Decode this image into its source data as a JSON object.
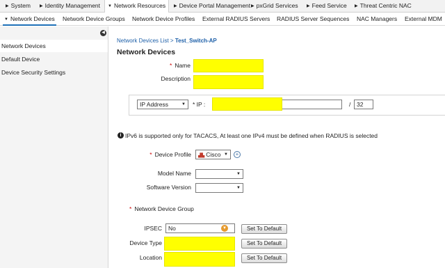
{
  "top_menu": [
    {
      "label": "System"
    },
    {
      "label": "Identity Management"
    },
    {
      "label": "Network Resources"
    },
    {
      "label": "Device Portal Management"
    },
    {
      "label": "pxGrid Services"
    },
    {
      "label": "Feed Service"
    },
    {
      "label": "Threat Centric NAC"
    }
  ],
  "sub_tabs": [
    {
      "label": "Network Devices"
    },
    {
      "label": "Network Device Groups"
    },
    {
      "label": "Network Device Profiles"
    },
    {
      "label": "External RADIUS Servers"
    },
    {
      "label": "RADIUS Server Sequences"
    },
    {
      "label": "NAC Managers"
    },
    {
      "label": "External MDM"
    }
  ],
  "sidebar": {
    "items": [
      {
        "label": "Network Devices"
      },
      {
        "label": "Default Device"
      },
      {
        "label": "Device Security Settings"
      }
    ]
  },
  "breadcrumb": {
    "parent": "Network Devices List",
    "separator": ">",
    "current": "Test_Switch-AP"
  },
  "page_title": "Network Devices",
  "form": {
    "name_label": "Name",
    "description_label": "Description",
    "ip_type": "IP Address",
    "ip_label": "* IP :",
    "mask_separator": "/",
    "mask_value": "32",
    "ipv6_note": "IPv6 is supported only for TACACS, At least one IPv4 must be defined when RADIUS is selected",
    "device_profile_label": "Device Profile",
    "device_profile_value": "Cisco",
    "model_name_label": "Model Name",
    "software_version_label": "Software Version",
    "ndg_label": "Network Device Group",
    "ipsec_label": "IPSEC",
    "ipsec_value": "No",
    "device_type_label": "Device Type",
    "location_label": "Location",
    "set_default_label": "Set To Default"
  },
  "colors": {
    "highlight": "#ffff00",
    "link": "#1d5fa8",
    "active_tab": "#1d70b8"
  }
}
